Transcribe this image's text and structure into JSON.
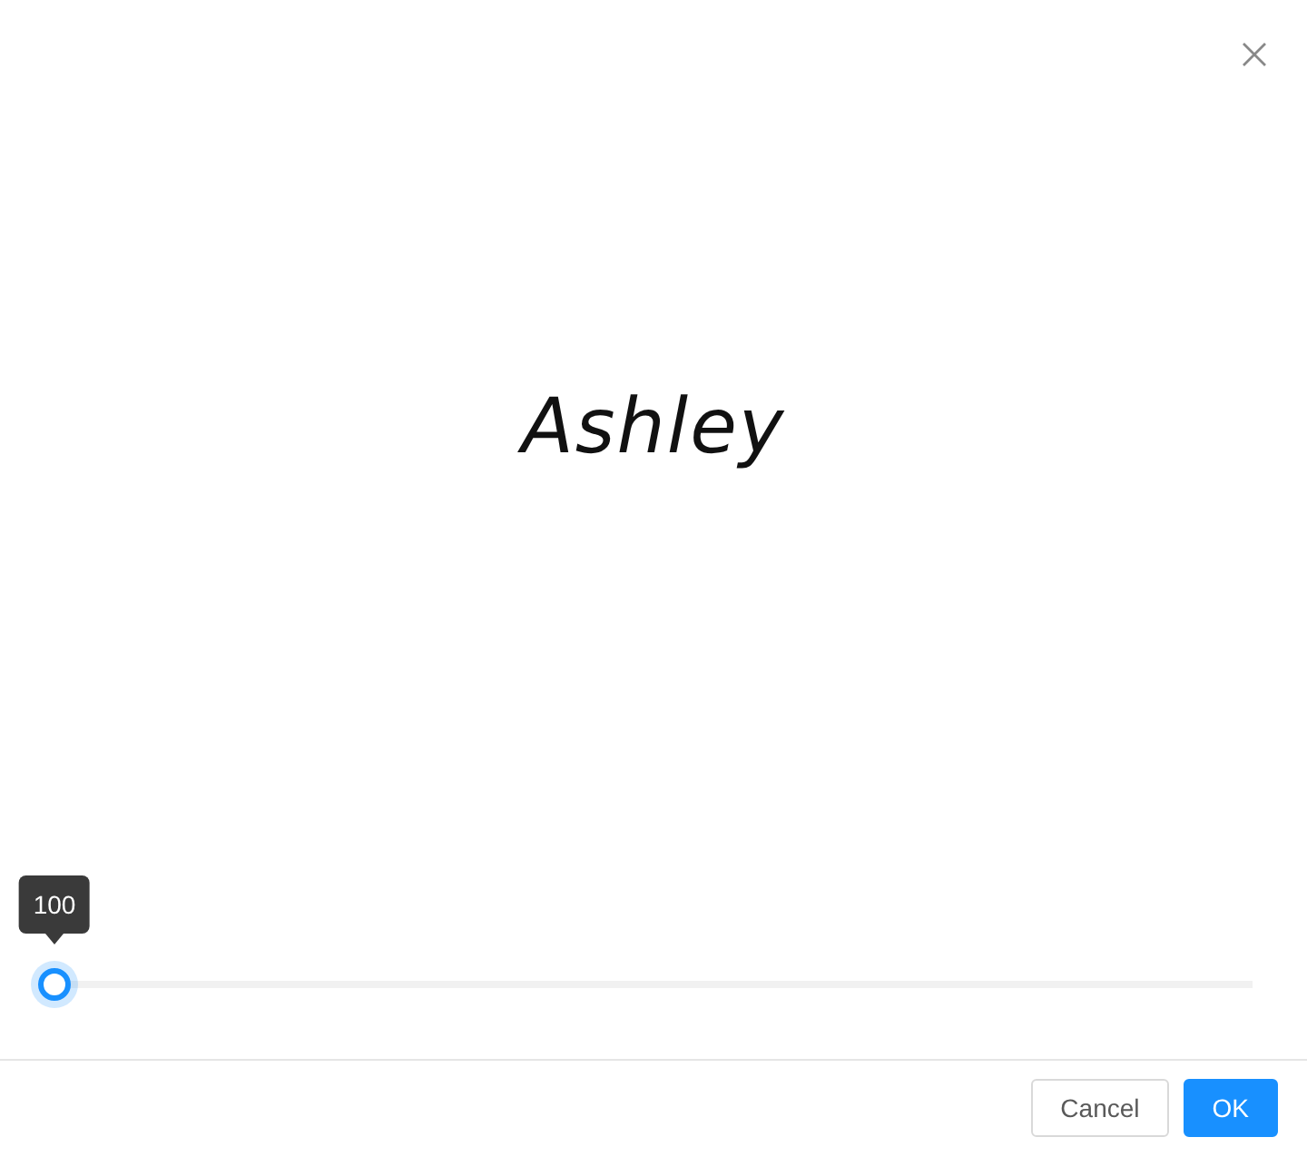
{
  "signature": {
    "text": "Ashley"
  },
  "slider": {
    "level": 0,
    "tooltip": "100"
  },
  "buttons": [
    {
      "label": "Cancel",
      "kind": "secondary"
    },
    {
      "label": "OK",
      "kind": "primary"
    }
  ]
}
